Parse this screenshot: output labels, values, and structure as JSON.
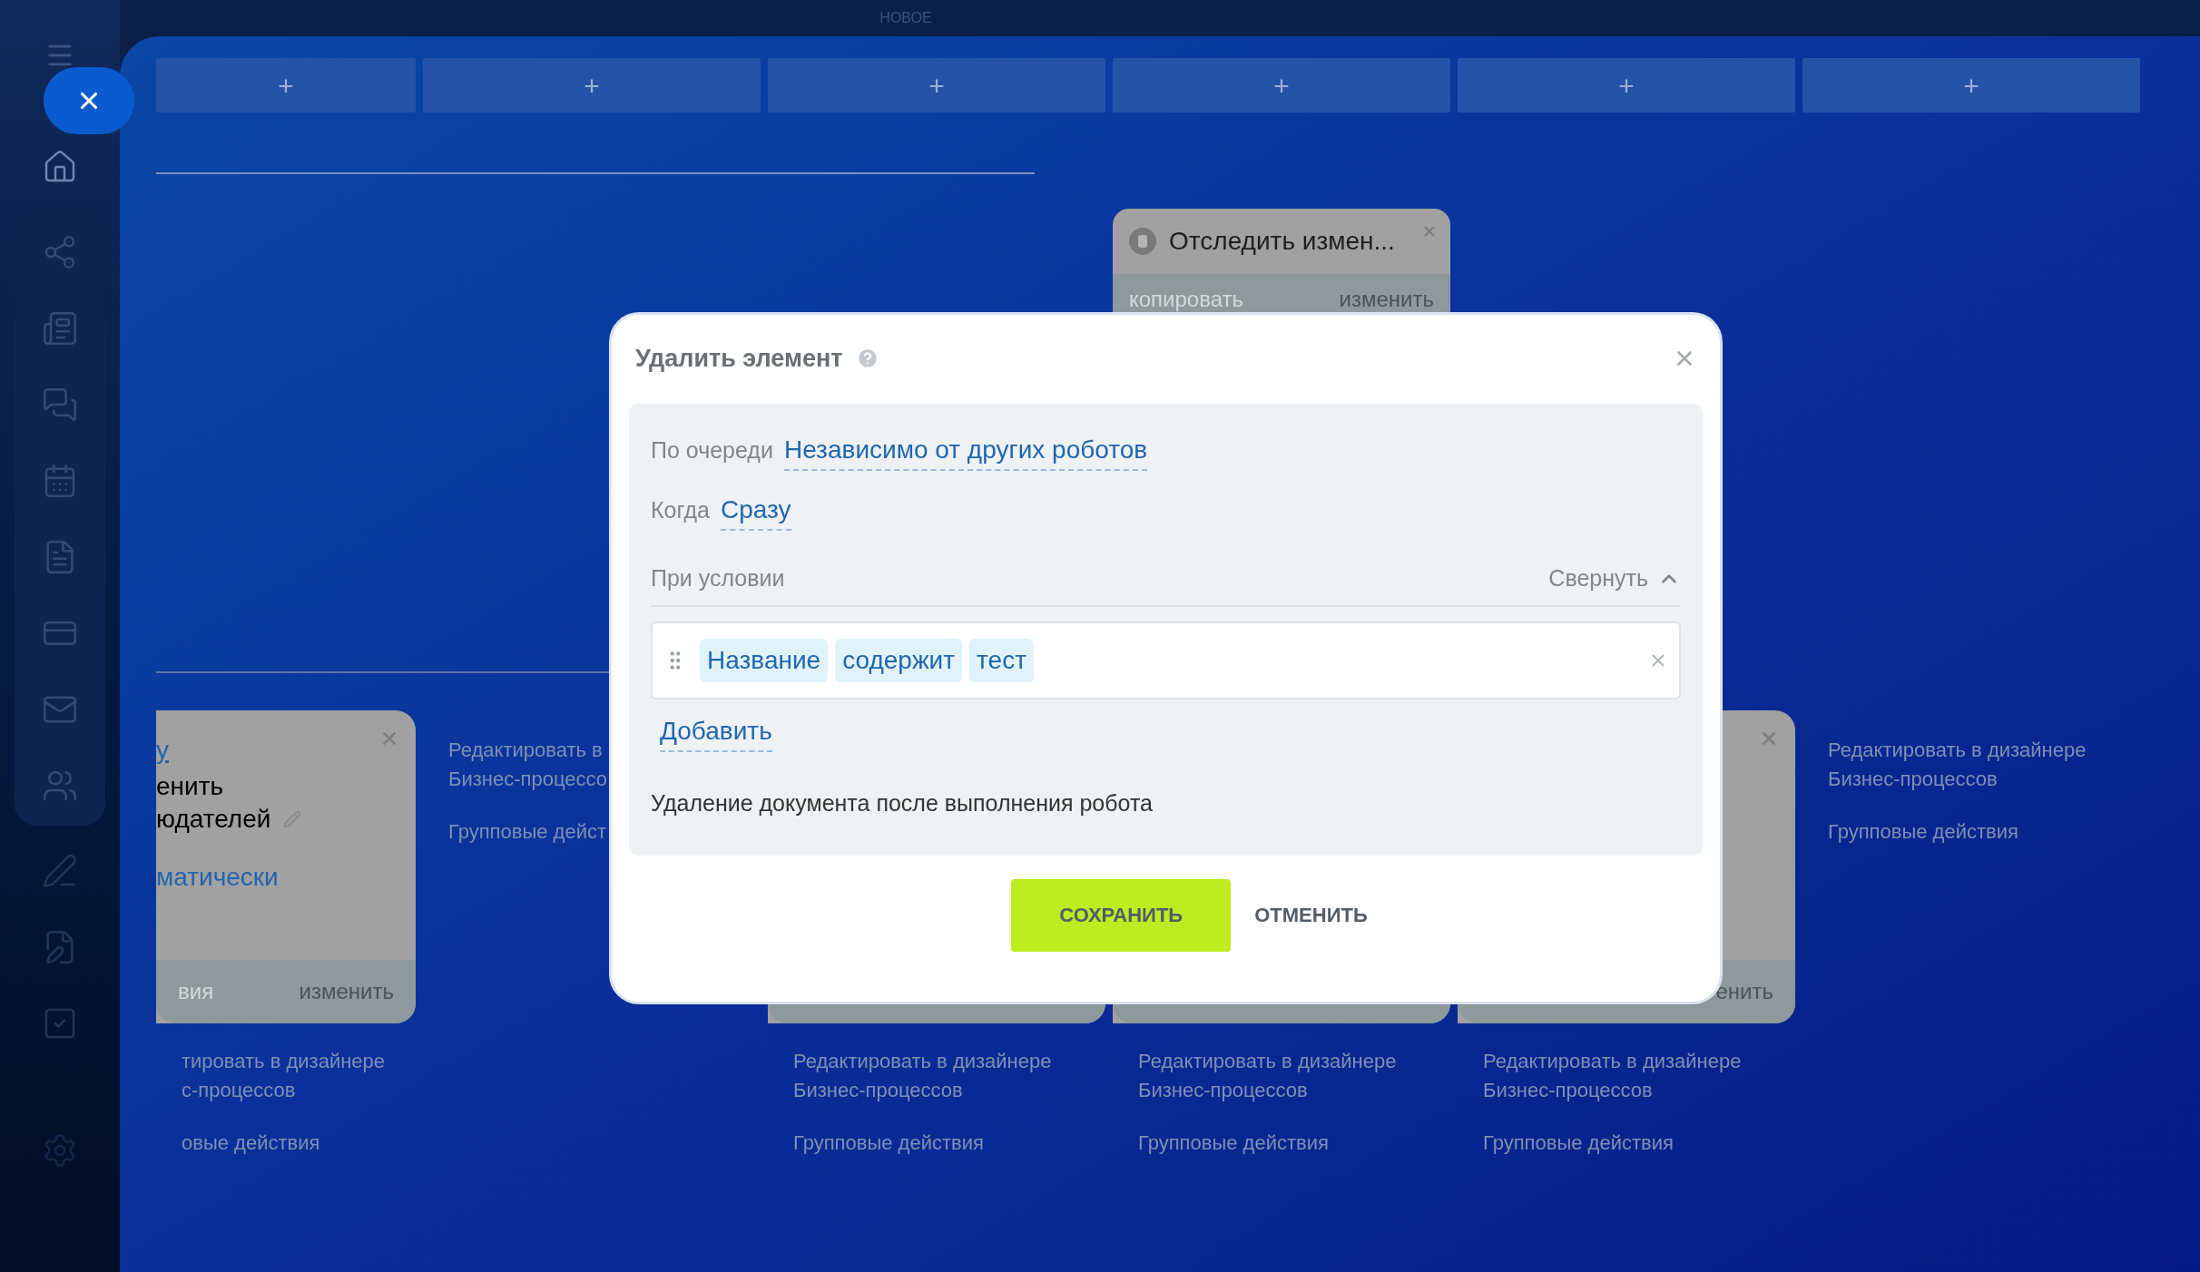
{
  "board": {
    "stage_label": "НОВОЕ",
    "add_buttons": [
      "+",
      "+",
      "+",
      "+",
      "+",
      "+"
    ],
    "columns": [
      {
        "card": {
          "closable": true,
          "lines": [
            {
              "kind": "link",
              "text": "у"
            },
            {
              "kind": "text",
              "text": "енить"
            },
            {
              "kind": "editable",
              "text": "юдателей"
            },
            {
              "kind": "value",
              "text": "матически"
            }
          ],
          "actions": [
            {
              "text": "вия",
              "disabled": true
            },
            {
              "text": "изменить",
              "disabled": false
            }
          ]
        },
        "links": [
          {
            "lines": [
              "тировать в дизайнере",
              "с-процессов"
            ]
          },
          {
            "lines": [
              "овые действия"
            ]
          }
        ]
      },
      {
        "links": [
          {
            "lines": [
              "Редактировать в",
              "Бизнес-процессо"
            ]
          },
          {
            "lines": [
              "Групповые дейст"
            ]
          }
        ]
      },
      {
        "card": {
          "closable": false
        },
        "links": [
          {
            "lines": [
              "Редактировать в дизайнере",
              "Бизнес-процессов"
            ]
          },
          {
            "lines": [
              "Групповые действия"
            ]
          }
        ]
      },
      {
        "top_card": {
          "title": "Отследить измен...",
          "actions": [
            {
              "text": "копировать",
              "disabled": true
            },
            {
              "text": "изменить",
              "disabled": false
            }
          ]
        },
        "card": {
          "closable": false
        },
        "links": [
          {
            "lines": [
              "Редактировать в дизайнере",
              "Бизнес-процессов"
            ]
          },
          {
            "lines": [
              "Групповые действия"
            ]
          }
        ]
      },
      {
        "card": {
          "closable": true,
          "actions": [
            {
              "text": "енить",
              "disabled": false
            }
          ]
        },
        "links": [
          {
            "lines": [
              "Редактировать в дизайнере",
              "Бизнес-процессов"
            ]
          },
          {
            "lines": [
              "Групповые действия"
            ]
          }
        ]
      },
      {
        "links": [
          {
            "lines": [
              "Редактировать в дизайнере",
              "Бизнес-процессов"
            ]
          },
          {
            "lines": [
              "Групповые действия"
            ]
          }
        ]
      }
    ]
  },
  "dialog": {
    "title": "Удалить элемент",
    "fields": [
      {
        "label": "По очереди",
        "value": "Независимо от других роботов"
      },
      {
        "label": "Когда",
        "value": "Сразу"
      }
    ],
    "condition": {
      "label": "При условии",
      "toggle": "Свернуть",
      "expanded": true,
      "chips": [
        "Название",
        "содержит",
        "тест"
      ],
      "add": "Добавить"
    },
    "description": "Удаление документа после выполнения робота",
    "buttons": [
      {
        "kind": "primary",
        "label": "СОХРАНИТЬ"
      },
      {
        "kind": "secondary",
        "label": "ОТМЕНИТЬ"
      }
    ]
  }
}
